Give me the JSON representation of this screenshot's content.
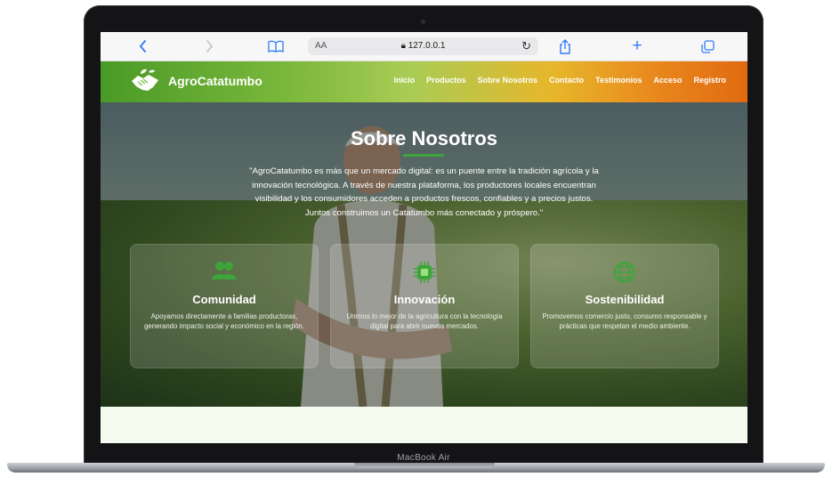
{
  "browser": {
    "back_icon": "chevron-left-icon",
    "aa_label": "AA",
    "url": "127.0.0.1"
  },
  "site": {
    "brand": "AgroCatatumbo",
    "nav": [
      "Inicio",
      "Productos",
      "Sobre Nosotros",
      "Contacto",
      "Testimonios",
      "Acceso",
      "Registro"
    ]
  },
  "hero": {
    "title": "Sobre Nosotros",
    "text": "\"AgroCatatumbo es más que un mercado digital: es un puente entre la tradición agrícola y la innovación tecnológica. A través de nuestra plataforma, los productores locales encuentran visibilidad y los consumidores acceden a productos frescos, confiables y a precios justos. Juntos construimos un Catatumbo más conectado y próspero.\""
  },
  "cards": [
    {
      "icon": "users-icon",
      "title": "Comunidad",
      "text": "Apoyamos directamente a familias productoras, generando impacto social y económico en la región."
    },
    {
      "icon": "chip-icon",
      "title": "Innovación",
      "text": "Unimos lo mejor de la agricultura con la tecnología digital para abrir nuevos mercados."
    },
    {
      "icon": "globe-icon",
      "title": "Sostenibilidad",
      "text": "Promovemos comercio justo, consumo responsable y prácticas que respetan el medio ambiente."
    }
  ],
  "device_label": "MacBook Air",
  "colors": {
    "accent_green": "#3ea53a",
    "nav_orange": "#e06b10",
    "safari_blue": "#2f7cf6"
  }
}
